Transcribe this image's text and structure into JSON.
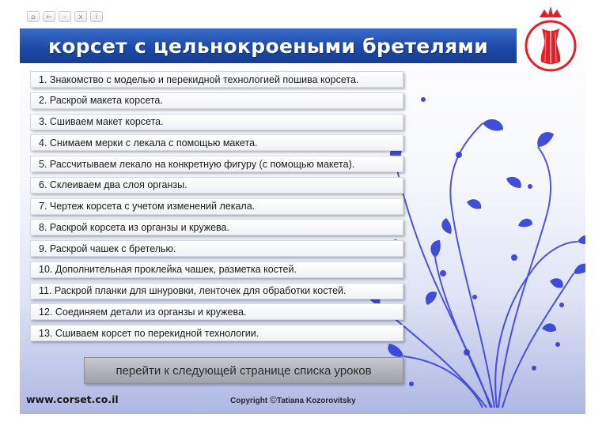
{
  "window": {
    "controls": [
      {
        "name": "home-icon",
        "glyph": "⌂"
      },
      {
        "name": "back-icon",
        "glyph": "←"
      },
      {
        "name": "minimize-icon",
        "glyph": "–"
      },
      {
        "name": "close-icon",
        "glyph": "x"
      },
      {
        "name": "info-icon",
        "glyph": "i"
      }
    ]
  },
  "header": {
    "title": "корсет с цельнокроеными бретелями"
  },
  "lessons": [
    "1. Знакомство с моделью и перекидной технологией пошива корсета.",
    "2. Раскрой макета корсета.",
    "3. Сшиваем макет корсета.",
    "4. Снимаем мерки с лекала с помощью макета.",
    "5. Рассчитываем лекало на конкретную фигуру (с помощью макета).",
    "6. Склеиваем два слоя органзы.",
    "7. Чертеж корсета с учетом изменений лекала.",
    "8. Раскрой корсета из органзы и кружева.",
    "9. Раскрой чашек с бретелью.",
    "10. Дополнительная проклейка чашек, разметка костей.",
    "11. Раскрой планки для шнуровки, ленточек для обработки костей.",
    "12. Соединяем детали из органзы и кружева.",
    "13. Сшиваем корсет по перекидной технологии."
  ],
  "navigation": {
    "next_label": "перейти к следующей странице списка уроков"
  },
  "footer": {
    "site": "www.corset.co.il",
    "copyright_symbol": "©",
    "copyright_prefix": "Copyright ",
    "copyright_name": "Tatiana Kozorovitsky"
  },
  "colors": {
    "title_bar": "#1e4aa8",
    "logo_red": "#e0202a",
    "floral_blue": "#2f3bd6"
  }
}
